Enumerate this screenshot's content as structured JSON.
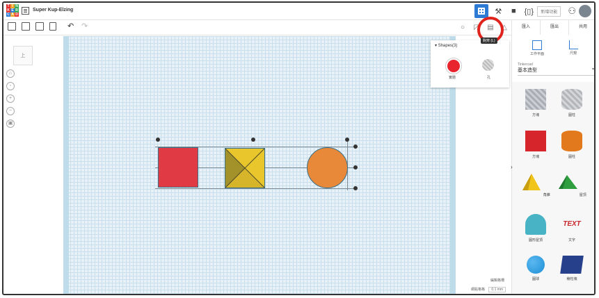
{
  "header": {
    "logo_letters": [
      "T",
      "I",
      "N",
      "K",
      "E",
      "R",
      "C",
      "A",
      "D"
    ],
    "project_title": "Super Kup-Elzing",
    "new_feature_label": "新增功能"
  },
  "toolbar": {
    "tooltip": "對齊 (L)"
  },
  "side_tabs": [
    "匯入",
    "匯出",
    "共用"
  ],
  "view_cube_label": "上",
  "shapes_panel": {
    "title": "Shapes(3)",
    "solid_label": "實體",
    "hole_label": "孔"
  },
  "right_panel": {
    "workplane_label": "工作平面",
    "ruler_label": "尺規",
    "library_source": "Tinkercad",
    "library_name": "基本造型",
    "items": [
      {
        "label": "方塊",
        "color": "#a9adb4"
      },
      {
        "label": "圓柱",
        "color": "#b3b6bb"
      },
      {
        "label": "方塊",
        "color": "#d6262c"
      },
      {
        "label": "圓柱",
        "color": "#e27a1d"
      },
      {
        "label": "角錐",
        "color": "#f0c419"
      },
      {
        "label": "屋頂",
        "color": "#2f9e3f"
      },
      {
        "label": "圓形屋頂",
        "color": "#48b3c4"
      },
      {
        "label": "文字",
        "color": "#c8252b"
      },
      {
        "label": "圓球",
        "color": "#1d8fd6"
      },
      {
        "label": "稜柱塊",
        "color": "#26408c"
      }
    ]
  },
  "footer": {
    "edit_grid": "編輯格柵",
    "snap_label": "網點格格",
    "snap_value": "0.1 mm"
  },
  "colors": {
    "accent": "#2e7bd6",
    "highlight": "#e0231c",
    "red_box": "#e03a45",
    "yellow_box": "#e8c62c",
    "orange_circle": "#e8893a"
  }
}
